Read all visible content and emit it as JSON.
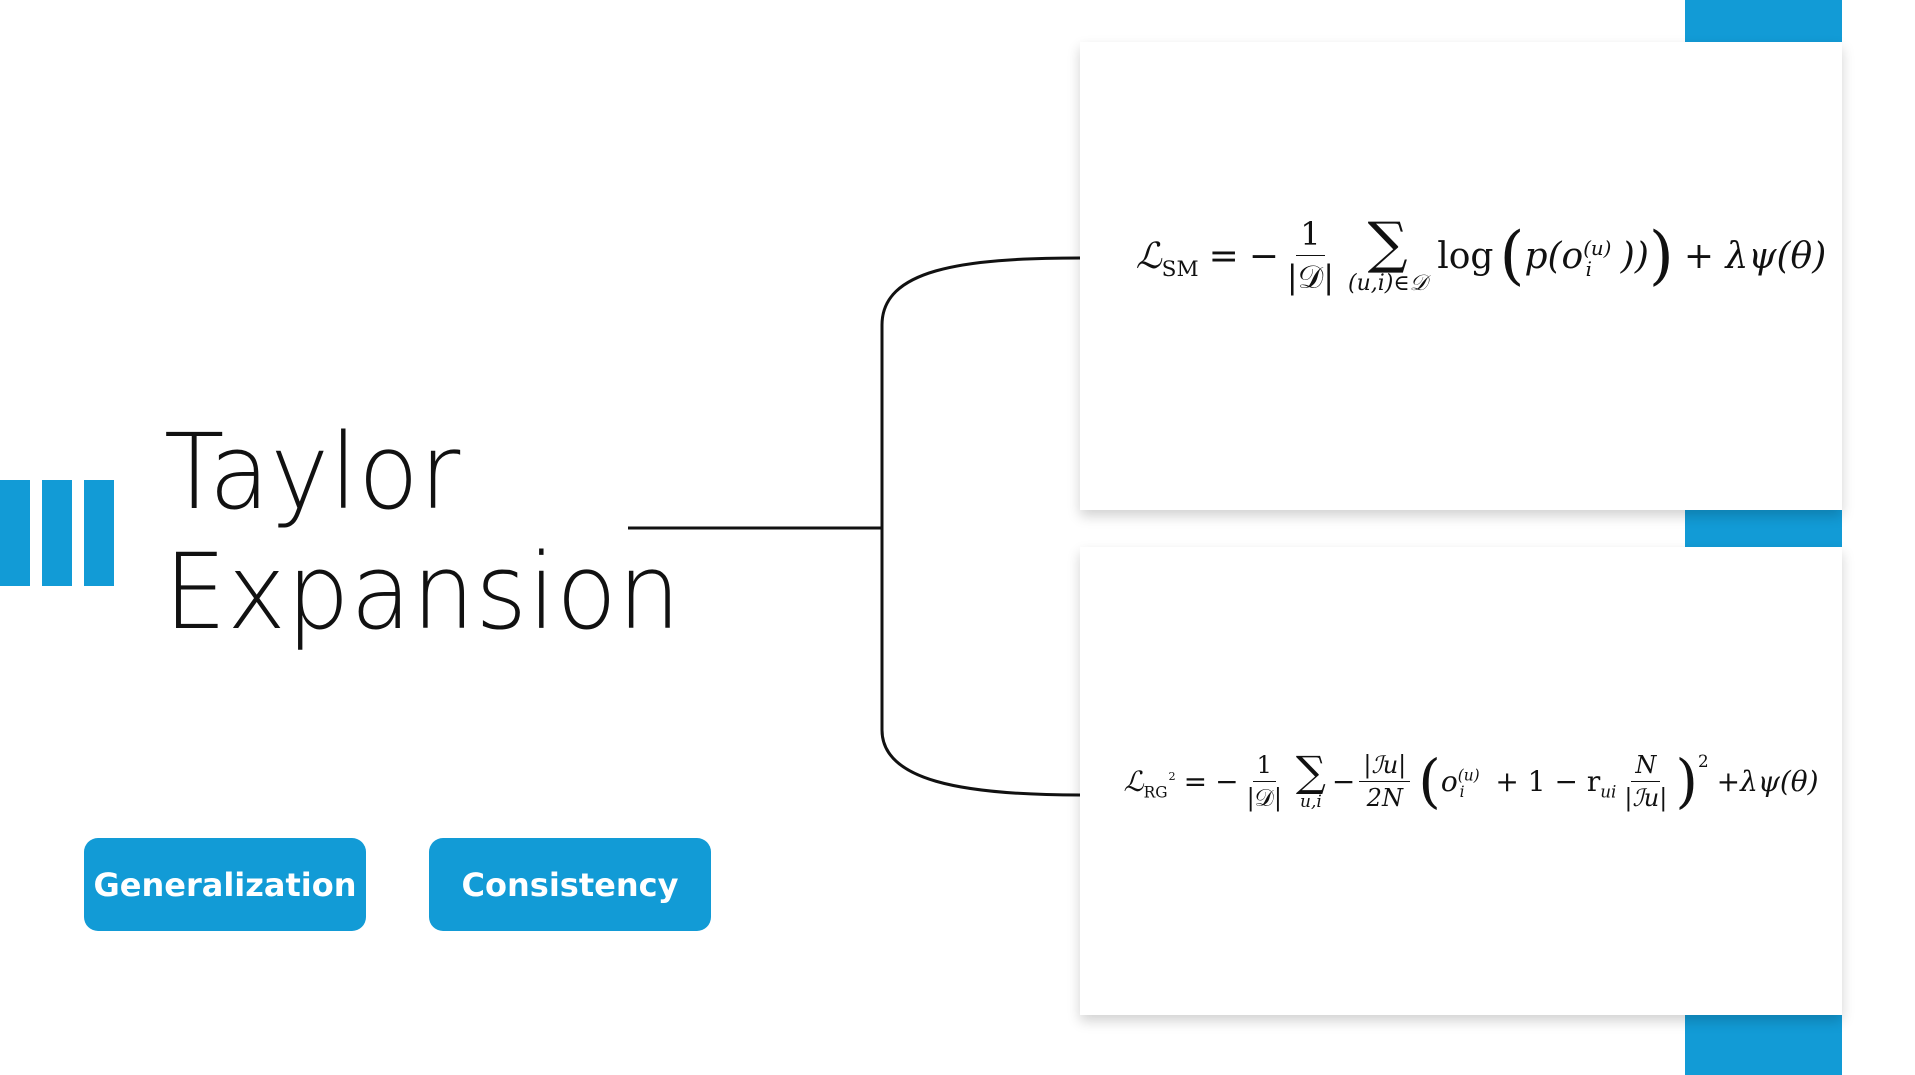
{
  "title": {
    "line1": "Taylor",
    "line2": "Expansion"
  },
  "buttons": {
    "generalization": "Generalization",
    "consistency": "Consistency"
  },
  "formula_sm": {
    "loss": "ℒ",
    "loss_sub": "SM",
    "equals": "=",
    "minus": "−",
    "frac_num": "1",
    "frac_den": "|𝒟|",
    "sigma": "∑",
    "sum_sub": "(u,i)∈𝒟",
    "log": "log",
    "paren_open": "(",
    "p": "p(o",
    "o_sup": "(u)",
    "o_sub": "i",
    "p_close": "))",
    "paren_close": ")",
    "reg": "+ λψ(θ)"
  },
  "formula_rg": {
    "loss": "ℒ",
    "loss_sub": "RG",
    "loss_sub_sup": "2",
    "equals": "=",
    "minus": "−",
    "frac_num": "1",
    "frac_den": "|𝒟|",
    "sigma": "∑",
    "sum_sub": "u,i",
    "minus2": "−",
    "frac2_num": "|ℐu|",
    "frac2_den": "2N",
    "paren_open": "(",
    "o": "o",
    "o_sup": "(u)",
    "o_sub": "i",
    "mid": "+ 1 − r",
    "r_sub": "ui",
    "frac3_num": "N",
    "frac3_den": "|ℐu|",
    "paren_close": ")",
    "power": "2",
    "reg": "+λψ(θ)"
  },
  "colors": {
    "accent": "#129bd6",
    "text": "#111111",
    "background": "#ffffff"
  }
}
